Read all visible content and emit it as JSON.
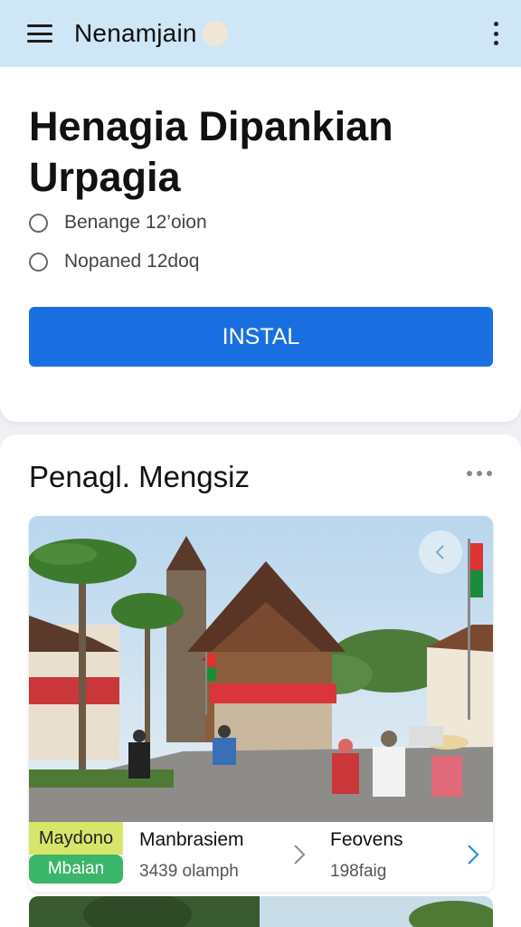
{
  "appbar": {
    "title": "Nenamjain",
    "menu_icon": "hamburger-menu-icon",
    "more_icon": "more-vertical-icon"
  },
  "hero": {
    "headline": "Henagia Dipankian Urpagia",
    "options": [
      {
        "label": "Benange 12’oion"
      },
      {
        "label": "Nopaned 12doq"
      }
    ],
    "install_label": "INSTAL"
  },
  "section": {
    "title": "Penagl. Mengsiz",
    "more_icon": "more-horizontal-icon",
    "card": {
      "back_icon": "chevron-left-icon",
      "badge_top": "Maydono",
      "badge_bottom": "Mbaian",
      "col1_title": "Manbrasiem",
      "col1_sub": "3439 olamph",
      "col2_title": "Feovens",
      "col2_sub": "198faig",
      "chevron_icon": "chevron-right-icon"
    }
  },
  "colors": {
    "appbar": "#cfe6f7",
    "accent": "#1a6fe0",
    "badge_yellow": "#d7e66a",
    "badge_green": "#3bb56a"
  }
}
